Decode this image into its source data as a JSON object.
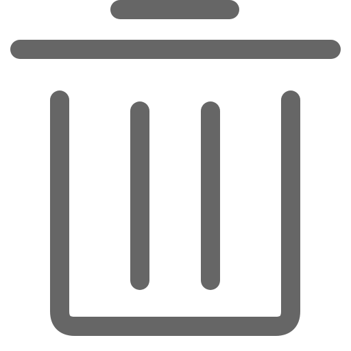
{
  "icon": {
    "name": "trash-icon",
    "color": "#666666"
  }
}
